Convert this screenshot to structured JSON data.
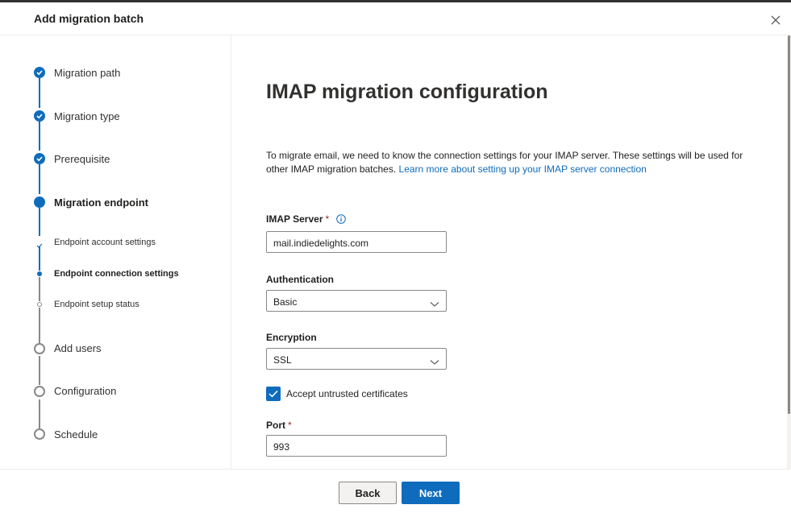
{
  "header": {
    "title": "Add migration batch",
    "close_icon": "close-icon"
  },
  "steps": [
    {
      "label": "Migration path",
      "state": "done"
    },
    {
      "label": "Migration type",
      "state": "done"
    },
    {
      "label": "Prerequisite",
      "state": "done"
    },
    {
      "label": "Migration endpoint",
      "state": "current"
    },
    {
      "label": "Add users",
      "state": "pending"
    },
    {
      "label": "Configuration",
      "state": "pending"
    },
    {
      "label": "Schedule",
      "state": "pending"
    }
  ],
  "substeps": [
    {
      "label": "Endpoint account settings",
      "state": "done"
    },
    {
      "label": "Endpoint connection settings",
      "state": "current"
    },
    {
      "label": "Endpoint setup status",
      "state": "pending"
    }
  ],
  "main": {
    "heading": "IMAP migration configuration",
    "description": "To migrate email, we need to know the connection settings for your IMAP server. These settings will be used for other IMAP migration batches. ",
    "learn_more": "Learn more about setting up your IMAP server connection",
    "imap_server": {
      "label": "IMAP Server",
      "required": "*",
      "value": "mail.indiedelights.com"
    },
    "authentication": {
      "label": "Authentication",
      "value": "Basic"
    },
    "encryption": {
      "label": "Encryption",
      "value": "SSL"
    },
    "accept_untrusted": {
      "label": "Accept untrusted certificates",
      "checked": true
    },
    "port": {
      "label": "Port",
      "required": "*",
      "value": "993"
    }
  },
  "footer": {
    "back_label": "Back",
    "next_label": "Next"
  },
  "colors": {
    "accent": "#0f6cbd",
    "pending": "#8a8886",
    "required": "#a4262c"
  }
}
